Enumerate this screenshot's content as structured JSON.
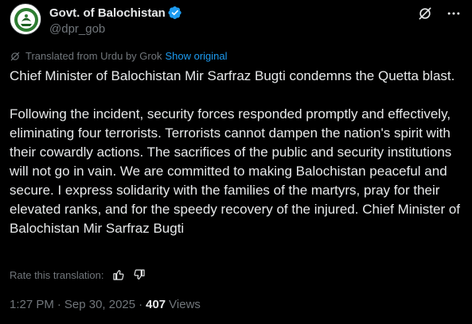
{
  "post": {
    "author": {
      "display_name": "Govt. of Balochistan",
      "handle": "@dpr_gob",
      "verified": true,
      "avatar_icon": "government-seal-avatar"
    },
    "actions": {
      "grok_icon": "grok-icon",
      "more_icon": "more-options-icon"
    },
    "translation_notice": {
      "text": "Translated from Urdu by Grok",
      "link": "Show original"
    },
    "text": " Chief Minister of Balochistan Mir Sarfraz Bugti condemns the Quetta blast.\n\nFollowing the incident, security forces responded promptly and effectively, eliminating four terrorists. Terrorists cannot dampen the nation's spirit with their cowardly actions. The sacrifices of the public and security institutions will not go in vain. We are committed to making Balochistan peaceful and secure. I express solidarity with the families of the martyrs, pray for their elevated ranks, and for the speedy recovery of the injured. Chief Minister of Balochistan Mir Sarfraz Bugti",
    "rate_translation": {
      "label": "Rate this translation:"
    },
    "meta": {
      "time": "1:27 PM",
      "separator": "·",
      "date": "Sep 30, 2025",
      "views_count": "407",
      "views_label": "Views"
    }
  },
  "colors": {
    "background": "#000000",
    "text": "#e7e9ea",
    "muted": "#71767b",
    "link": "#1d9bf0",
    "verified": "#1d9bf0"
  }
}
